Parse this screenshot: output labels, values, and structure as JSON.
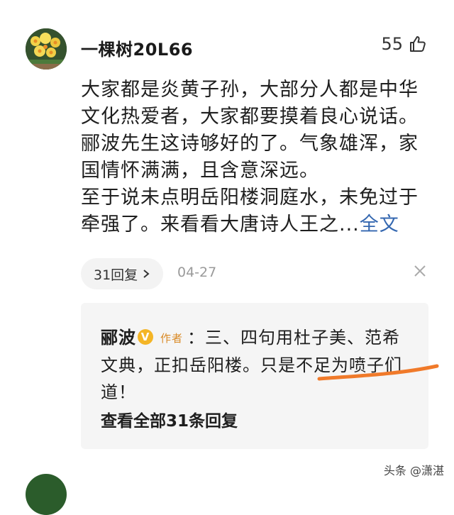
{
  "comment": {
    "username": "一棵树20L66",
    "like_count": "55",
    "paragraphs": [
      "大家都是炎黄子孙，大部分人都是中华文化热爱者，大家都要摸着良心说话。",
      "郦波先生这诗够好的了。气象雄浑，家国情怀满满，且含意深远。",
      "至于说未点明岳阳楼洞庭水，未免过于牵强了。来看看大唐诗人王之..."
    ],
    "full_text_link": "全文",
    "reply_count_label": "31回复",
    "date": "04-27"
  },
  "reply": {
    "author": "郦波",
    "author_tag": "作者",
    "text": "：三、四句用杜子美、范希文典，正扣岳阳楼。只是不足为喷子们道！",
    "view_all_label": "查看全部31条回复"
  },
  "watermark": "头条 @潇湛",
  "colors": {
    "link": "#3467b0",
    "badge": "#f4b526",
    "author_tag": "#d98a26",
    "annotation": "#f07a2a"
  },
  "icons": {
    "like": "thumbs-up-icon",
    "close": "close-icon",
    "chevron": "chevron-right-icon",
    "verified": "verified-badge-icon"
  }
}
